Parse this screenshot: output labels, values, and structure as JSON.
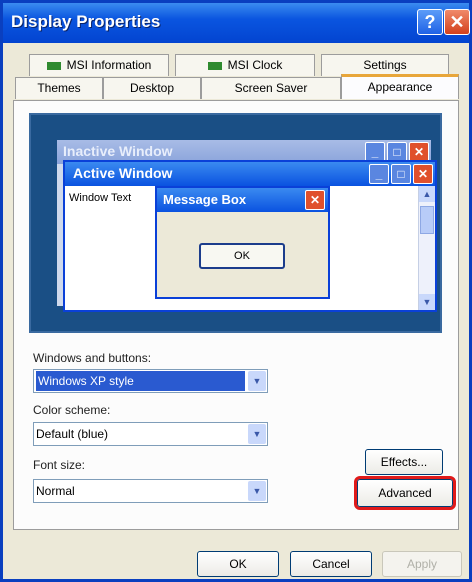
{
  "window": {
    "title": "Display Properties",
    "help_glyph": "?",
    "close_glyph": "✕"
  },
  "tabs_row1": [
    {
      "label": "MSI Information"
    },
    {
      "label": "MSI Clock"
    },
    {
      "label": "Settings"
    }
  ],
  "tabs_row2": [
    {
      "label": "Themes"
    },
    {
      "label": "Desktop"
    },
    {
      "label": "Screen Saver"
    },
    {
      "label": "Appearance",
      "active": true
    }
  ],
  "preview": {
    "inactive_title": "Inactive Window",
    "active_title": "Active Window",
    "window_text": "Window Text",
    "message_box_title": "Message Box",
    "message_box_ok": "OK",
    "minimize_glyph": "_",
    "maximize_glyph": "□",
    "close_glyph": "✕",
    "scroll_up": "▲",
    "scroll_down": "▼"
  },
  "fields": {
    "windows_buttons_label": "Windows and buttons:",
    "windows_buttons_value": "Windows XP style",
    "color_scheme_label": "Color scheme:",
    "color_scheme_value": "Default (blue)",
    "font_size_label": "Font size:",
    "font_size_value": "Normal",
    "dropdown_glyph": "▼"
  },
  "buttons": {
    "effects": "Effects...",
    "advanced": "Advanced",
    "ok": "OK",
    "cancel": "Cancel",
    "apply": "Apply"
  },
  "colors": {
    "titlebar": "#0a55e0",
    "highlight_outline": "#e01a1a",
    "active_tab_accent": "#e8a63a"
  }
}
